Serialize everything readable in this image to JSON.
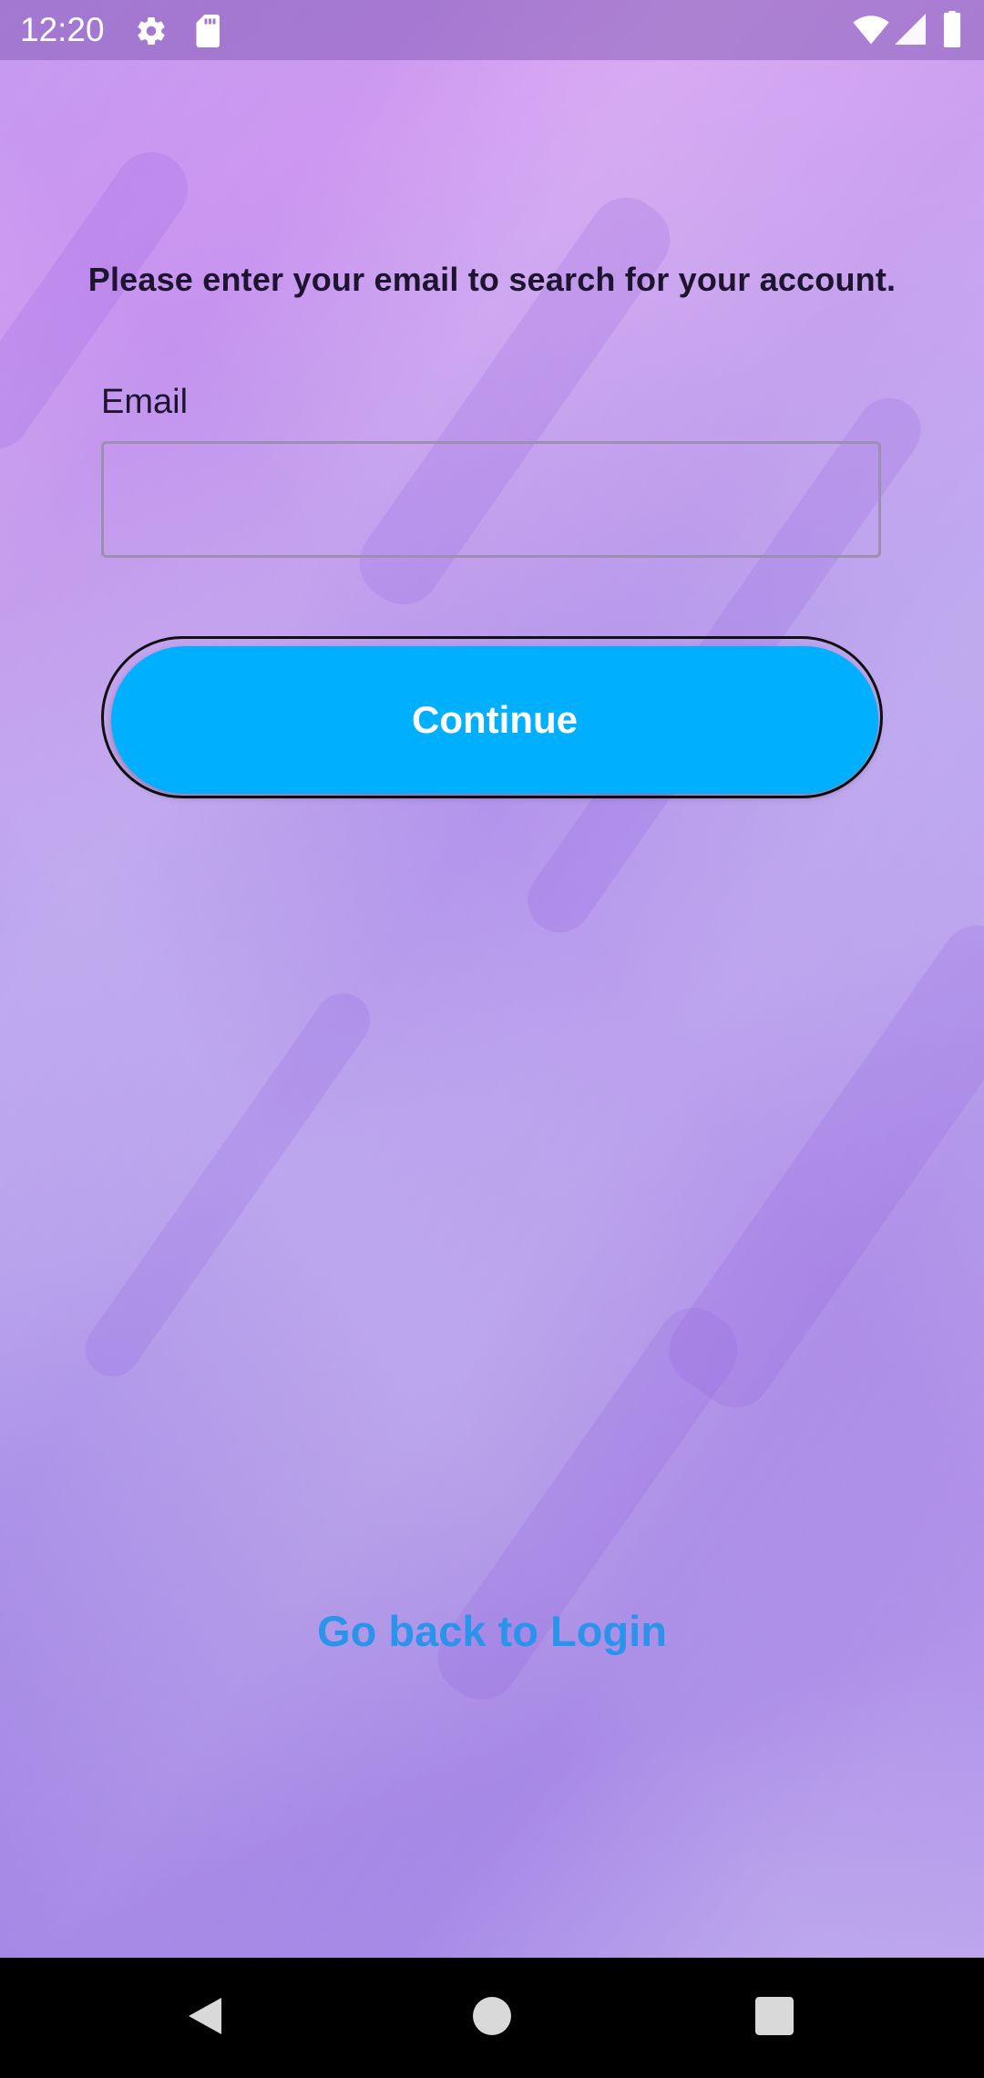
{
  "status_bar": {
    "time": "12:20",
    "icons": [
      "gear-icon",
      "sd-card-icon",
      "wifi-icon",
      "cellular-signal-icon",
      "battery-icon"
    ]
  },
  "form": {
    "instruction": "Please enter your email to search for your account.",
    "email_label": "Email",
    "email_value": "",
    "email_placeholder": "",
    "continue_label": "Continue"
  },
  "links": {
    "back_to_login": "Go back to Login"
  },
  "nav_bar": {
    "buttons": [
      "back-icon",
      "home-icon",
      "recents-icon"
    ]
  },
  "colors": {
    "accent_button": "#00b0fe",
    "link": "#2a93ea",
    "text_dark": "#1d1430",
    "background_purple": "#c29ef0"
  }
}
